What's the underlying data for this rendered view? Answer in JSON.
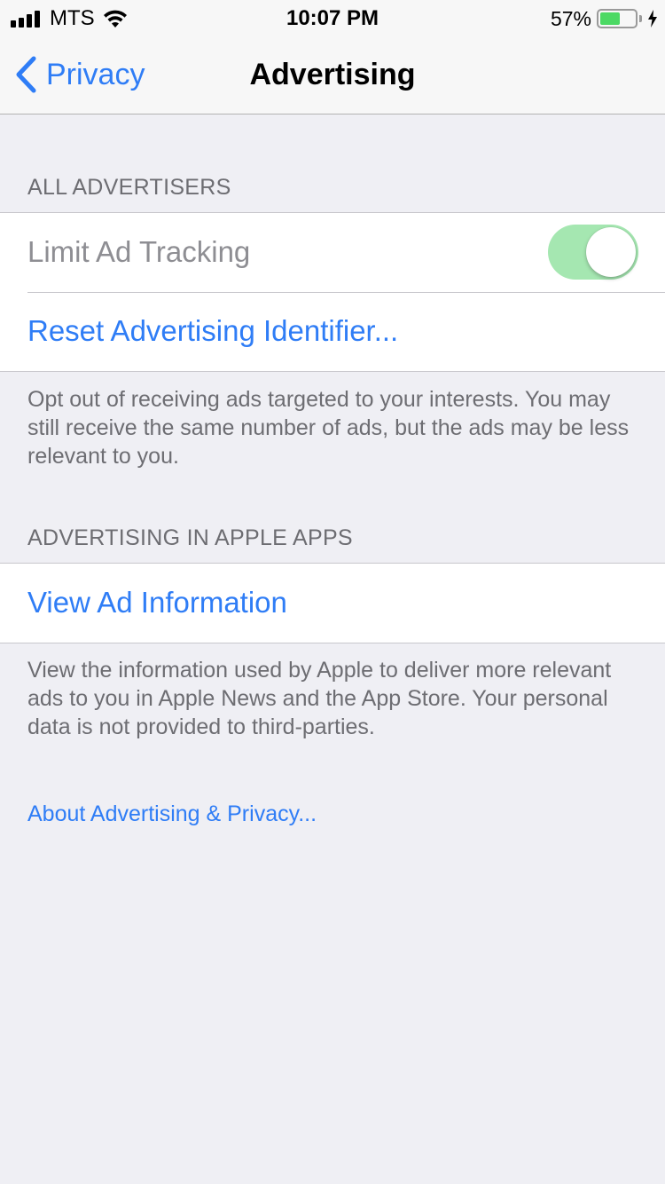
{
  "status_bar": {
    "carrier": "MTS",
    "time": "10:07 PM",
    "battery_percent": "57%",
    "battery_level": 0.57,
    "battery_color": "#4cd964",
    "charging": true,
    "signal_bars": 4
  },
  "nav": {
    "back_label": "Privacy",
    "title": "Advertising"
  },
  "sections": {
    "all_advertisers": {
      "header": "ALL ADVERTISERS",
      "limit_tracking_label": "Limit Ad Tracking",
      "limit_tracking_on": true,
      "reset_label": "Reset Advertising Identifier...",
      "footer": "Opt out of receiving ads targeted to your interests. You may still receive the same number of ads, but the ads may be less relevant to you."
    },
    "apple_apps": {
      "header": "ADVERTISING IN APPLE APPS",
      "view_info_label": "View Ad Information",
      "footer": "View the information used by Apple to deliver more relevant ads to you in Apple News and the App Store. Your personal data is not provided to third-parties."
    }
  },
  "about_link": "About Advertising & Privacy...",
  "colors": {
    "accent": "#2f7df6",
    "toggle_on": "#a5e7b1",
    "background": "#efeff4"
  }
}
